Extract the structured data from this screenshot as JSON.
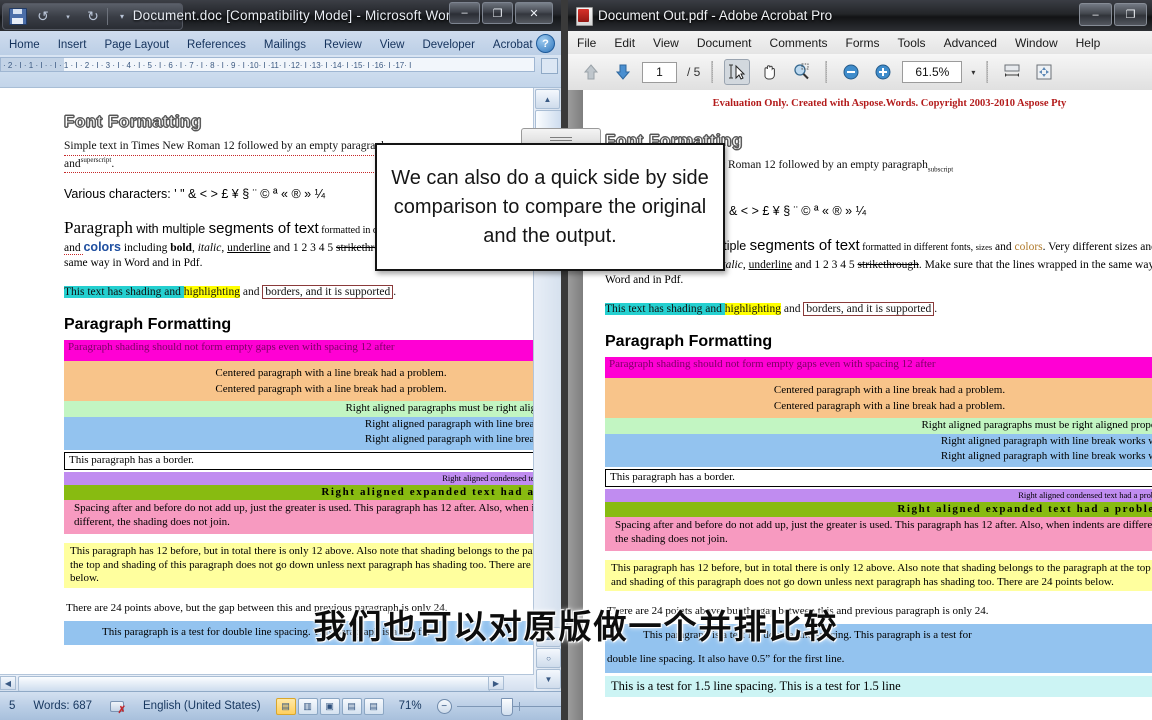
{
  "word": {
    "title": "Document.doc [Compatibility Mode] - Microsoft Word",
    "qat": {
      "save": "save-icon",
      "undo": "undo-icon",
      "redo": "redo-icon",
      "customize": "customize-icon"
    },
    "window_controls": {
      "minimize": "–",
      "maximize": "❐",
      "close": "✕"
    },
    "ribbon_tabs": [
      "Home",
      "Insert",
      "Page Layout",
      "References",
      "Mailings",
      "Review",
      "View",
      "Developer",
      "Acrobat"
    ],
    "help_label": "?",
    "ruler_ticks": "· 2 · I · 1 · I ·  · I · 1 · I · 2 · I · 3 · I · 4 · I · 5 · I · 6 · I · 7 · I · 8 · I · 9 · I ·10· I ·11· I ·12· I ·13· I ·14· I ·15· I ·16· I ·17· I",
    "status": {
      "page": "5",
      "words": "Words: 687",
      "language": "English (United States)",
      "zoom": "71%",
      "view_buttons": [
        "print-layout",
        "full-screen-reading",
        "web-layout",
        "outline",
        "draft"
      ]
    }
  },
  "acrobat": {
    "title": "Document Out.pdf - Adobe Acrobat Pro",
    "window_controls": {
      "minimize": "–",
      "maximize": "❐"
    },
    "menus": [
      "File",
      "Edit",
      "View",
      "Document",
      "Comments",
      "Forms",
      "Tools",
      "Advanced",
      "Window",
      "Help"
    ],
    "toolbar": {
      "prev_page": "up-arrow-icon",
      "next_page": "down-arrow-icon",
      "page_current": "1",
      "page_total": "/ 5",
      "select_tool": "select-text-icon",
      "hand_tool": "hand-icon",
      "marquee_zoom": "zoom-select-icon",
      "zoom_out": "zoom-out-icon",
      "zoom_in": "zoom-in-icon",
      "zoom_value": "61.5%",
      "zoom_dropdown": "▾",
      "fit_width": "fit-width-icon",
      "fit_page": "fit-page-icon"
    }
  },
  "callout": {
    "text": "We can also do a quick side by side comparison to compare the original and the output."
  },
  "subtitle": {
    "text": "我们也可以对原版做一个并排比较"
  },
  "document": {
    "eval_banner": "Evaluation Only. Created with Aspose.Words. Copyright 2003-2010 Aspose Pty",
    "h1_font": "Font Formatting",
    "p_simple_1": "Simple text in Times New Roman 12 followed by an empty paragraph",
    "p_simple_sub": "subscript",
    "p_simple_2": "and",
    "p_simple_sup": "superscript",
    "p_simple_end": ".",
    "p_chars": "Various characters: ' \" & < > £ ¥ § ¨ © ª « ® » ¼",
    "p_mixed_1": "Paragraph",
    "p_mixed_2": " with multiple ",
    "p_mixed_3": "segments of text",
    "p_mixed_4": " formatted in different fonts, ",
    "p_mixed_5": "sizes",
    "p_mixed_6": " and ",
    "p_mixed_colors": "colors",
    "p_mixed_7": ". Very different sizes and ",
    "p_mixed_colors2": "colors",
    "p_mixed_8": " including ",
    "p_mixed_bold": "bold",
    "p_mixed_9": ", ",
    "p_mixed_italic": "italic",
    "p_mixed_10": ", ",
    "p_mixed_underline": "underline",
    "p_mixed_11": " and 1 2 3 4 5 ",
    "p_mixed_strike": "strikethrough",
    "p_mixed_12": ". Make sure that the lines wrapped in the same way in Word and in Pdf.",
    "p_shading_1": "This text has shading and ",
    "p_shading_2": "highlighting",
    "p_shading_3": " and ",
    "p_shading_4": "borders, and it is supported",
    "p_shading_5": ".",
    "h1_paragraph": "Paragraph Formatting",
    "pf_magenta": "Paragraph shading should not form empty gaps even with spacing 12 after",
    "pf_center_1": "Centered paragraph with a line break had a problem.",
    "pf_center_2": "Centered paragraph with a line break had a problem.",
    "pf_right_green": "Right aligned paragraphs must be right aligned properly.",
    "pf_right_blue_1": "Right aligned paragraph with line break works well.",
    "pf_right_blue_2": "Right aligned paragraph with line break works well.",
    "pf_border": "This paragraph has a border.",
    "pf_condensed": "Right aligned condensed text had a problem.",
    "pf_expanded": "Right aligned expanded text had a problem.",
    "pf_pink": "Spacing after and before do not add up, just the greater is used. This paragraph has 12 after. Also, when indents are different, the shading does not join.",
    "pf_yellow": "This paragraph has 12 before, but in total there is only 12 above. Also note that shading belongs to the paragraph at the top and shading of this paragraph does not go down unless next paragraph has shading too. There are 24 points below.",
    "pf_24pts": "There are 24 points above, but the gap  between this and previous paragraph is only 24.",
    "pf_double_1": "This paragraph is a test for double line spacing. This paragraph is a test for",
    "pf_double_2": "double line spacing. It also have 0.5” for the first line.",
    "pf_15_line": "This is a test for 1.5 line spacing. This is a test for 1.5 line"
  },
  "colors": {
    "magenta": "#ff00d4",
    "orange": "#f8c48a",
    "green": "#c2f5c2",
    "blue": "#93c3ef",
    "purple": "#c08cf0",
    "olive": "#88bb11",
    "pink": "#f79ac0",
    "yellow": "#ffff9e",
    "cyan": "#25d0d0",
    "highlight_yellow": "#ffff00",
    "eval_red": "#b31b1b"
  }
}
